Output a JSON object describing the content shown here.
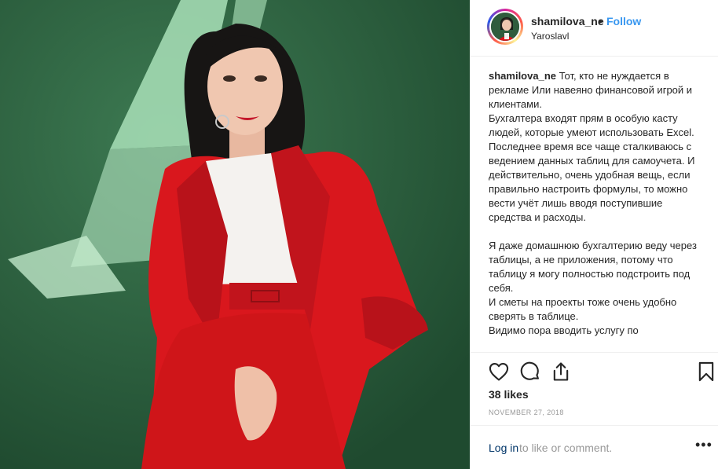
{
  "post": {
    "photo_alt": "post-photo",
    "header": {
      "username": "shamilova_ne",
      "separator": "•",
      "follow_label": "Follow",
      "location": "Yaroslavl"
    },
    "caption": {
      "username": "shamilova_ne",
      "text": " Тот, кто не нуждается в рекламе Или навеяно финансовой игрой и клиентами.\nБухгалтера входят прям в особую касту людей, которые умеют использовать Excel.\nПоследнее время все чаще сталкиваюсь с ведением данных таблиц для самоучета. И действительно, очень удобная вещь, если правильно настроить формулы, то можно вести учёт лишь вводя поступившие средства и расходы.\n\nЯ даже домашнюю бухгалтерию веду через таблицы, а не приложения, потому что таблицу я могу полностью подстроить под себя.\nИ сметы на проекты тоже очень удобно сверять в таблице.\nВидимо пора вводить услугу по"
    },
    "actions": {
      "like_icon": "heart-icon",
      "comment_icon": "comment-icon",
      "share_icon": "share-icon",
      "save_icon": "bookmark-icon"
    },
    "likes_label": "38 likes",
    "date": "NOVEMBER 27, 2018",
    "footer": {
      "login_label": "Log in",
      "login_rest": " to like or comment.",
      "more_label": "•••"
    }
  },
  "colors": {
    "follow": "#3897f0",
    "link": "#003569",
    "muted": "#999999",
    "photo_background": "#2f5c3d",
    "suit_red": "#d9171d"
  }
}
